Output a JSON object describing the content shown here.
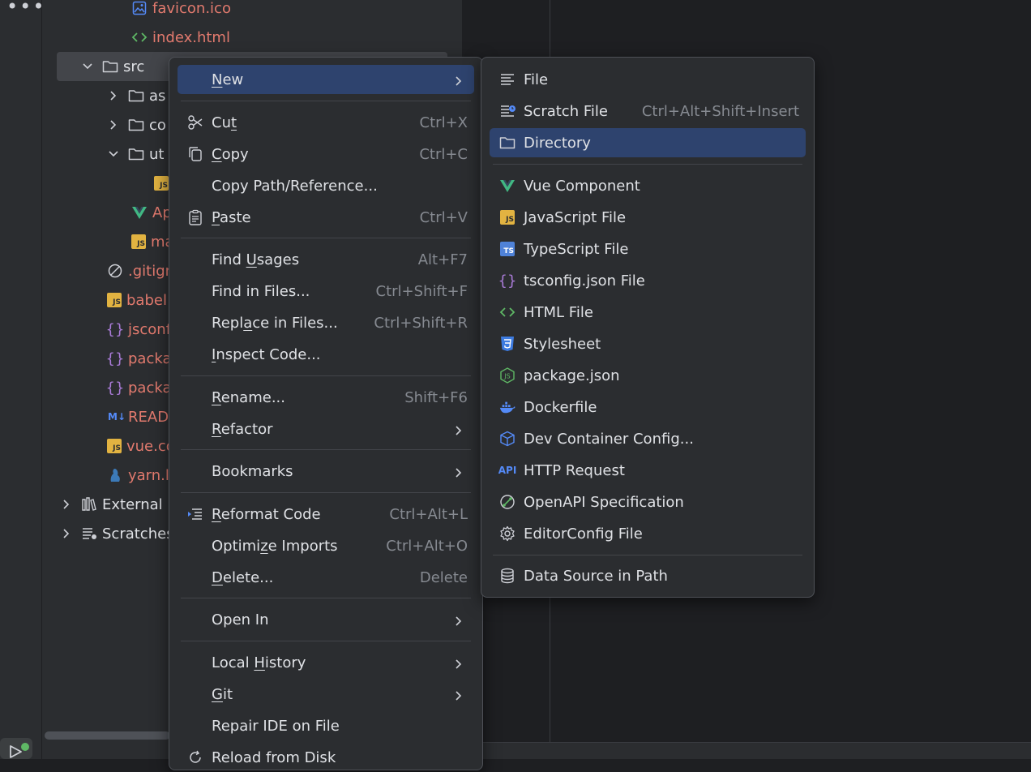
{
  "colors": {
    "background": "#1e1f22",
    "panel": "#2b2d30",
    "highlight": "#2e436e",
    "file_red": "#e27a6e",
    "js_badge": "#e2b341",
    "ts_badge": "#4f82d8",
    "vue": "#41b883"
  },
  "sidebar": {
    "more_icon": "more-horizontal-icon",
    "run_icon": "run-icon"
  },
  "tree": {
    "items": [
      {
        "label": "favicon.ico",
        "icon": "image-icon"
      },
      {
        "label": "index.html",
        "icon": "html-icon"
      },
      {
        "label": "src",
        "icon": "folder-icon"
      },
      {
        "label": "as",
        "icon": "folder-icon"
      },
      {
        "label": "co",
        "icon": "folder-icon"
      },
      {
        "label": "ut",
        "icon": "folder-icon"
      },
      {
        "label": "JS",
        "icon": "js-icon"
      },
      {
        "label": "Ap",
        "icon": "vue-icon"
      },
      {
        "label": "ma",
        "icon": "js-icon"
      },
      {
        "label": ".gitign",
        "icon": "ignore-icon"
      },
      {
        "label": "babel",
        "icon": "js-icon"
      },
      {
        "label": "jsconf",
        "icon": "json-icon"
      },
      {
        "label": "packa",
        "icon": "json-icon"
      },
      {
        "label": "packa",
        "icon": "json-icon"
      },
      {
        "label": "READ",
        "icon": "markdown-icon"
      },
      {
        "label": "vue.co",
        "icon": "js-icon"
      },
      {
        "label": "yarn.l",
        "icon": "yarn-icon"
      },
      {
        "label": "External",
        "icon": "library-icon"
      },
      {
        "label": "Scratches",
        "icon": "scratches-icon"
      }
    ]
  },
  "context_menu": {
    "new": {
      "pre": "",
      "u": "N",
      "post": "ew"
    },
    "cut": {
      "pre": "Cu",
      "u": "t",
      "post": "",
      "shortcut": "Ctrl+X"
    },
    "copy": {
      "pre": "",
      "u": "C",
      "post": "opy",
      "shortcut": "Ctrl+C"
    },
    "copy_path": {
      "label": "Copy Path/Reference..."
    },
    "paste": {
      "pre": "",
      "u": "P",
      "post": "aste",
      "shortcut": "Ctrl+V"
    },
    "find_usages": {
      "pre": "Find ",
      "u": "U",
      "post": "sages",
      "shortcut": "Alt+F7"
    },
    "find_in_files": {
      "label": "Find in Files...",
      "shortcut": "Ctrl+Shift+F"
    },
    "replace_in_files": {
      "pre": "Repl",
      "u": "a",
      "post": "ce in Files...",
      "shortcut": "Ctrl+Shift+R"
    },
    "inspect_code": {
      "pre": "",
      "u": "I",
      "post": "nspect Code..."
    },
    "rename": {
      "pre": "",
      "u": "R",
      "post": "ename...",
      "shortcut": "Shift+F6"
    },
    "refactor": {
      "pre": "",
      "u": "R",
      "post": "efactor"
    },
    "bookmarks": {
      "label": "Bookmarks"
    },
    "reformat_code": {
      "pre": "",
      "u": "R",
      "post": "eformat Code",
      "shortcut": "Ctrl+Alt+L"
    },
    "optimize_imports": {
      "pre": "Optimi",
      "u": "z",
      "post": "e Imports",
      "shortcut": "Ctrl+Alt+O"
    },
    "delete": {
      "pre": "",
      "u": "D",
      "post": "elete...",
      "shortcut": "Delete"
    },
    "open_in": {
      "label": "Open In"
    },
    "local_history": {
      "pre": "Local ",
      "u": "H",
      "post": "istory"
    },
    "git": {
      "pre": "",
      "u": "G",
      "post": "it"
    },
    "repair_ide": {
      "label": "Repair IDE on File"
    },
    "reload": {
      "label": "Reload from Disk"
    }
  },
  "new_submenu": {
    "items": [
      {
        "label": "File",
        "icon": "text-file-icon",
        "shortcut": ""
      },
      {
        "label": "Scratch File",
        "icon": "scratch-file-icon",
        "shortcut": "Ctrl+Alt+Shift+Insert"
      },
      {
        "label": "Directory",
        "icon": "folder-icon",
        "shortcut": ""
      },
      {
        "label": "Vue Component",
        "icon": "vue-icon",
        "shortcut": ""
      },
      {
        "label": "JavaScript File",
        "icon": "js-icon",
        "shortcut": ""
      },
      {
        "label": "TypeScript File",
        "icon": "ts-icon",
        "shortcut": ""
      },
      {
        "label": "tsconfig.json File",
        "icon": "json-icon",
        "shortcut": ""
      },
      {
        "label": "HTML File",
        "icon": "html-icon",
        "shortcut": ""
      },
      {
        "label": "Stylesheet",
        "icon": "css-icon",
        "shortcut": ""
      },
      {
        "label": "package.json",
        "icon": "nodejs-icon",
        "shortcut": ""
      },
      {
        "label": "Dockerfile",
        "icon": "docker-icon",
        "shortcut": ""
      },
      {
        "label": "Dev Container Config...",
        "icon": "dev-container-icon",
        "shortcut": ""
      },
      {
        "label": "HTTP Request",
        "icon": "api-icon",
        "shortcut": ""
      },
      {
        "label": "OpenAPI Specification",
        "icon": "openapi-icon",
        "shortcut": ""
      },
      {
        "label": "EditorConfig File",
        "icon": "gear-icon",
        "shortcut": ""
      },
      {
        "label": "Data Source in Path",
        "icon": "database-icon",
        "shortcut": ""
      }
    ]
  }
}
